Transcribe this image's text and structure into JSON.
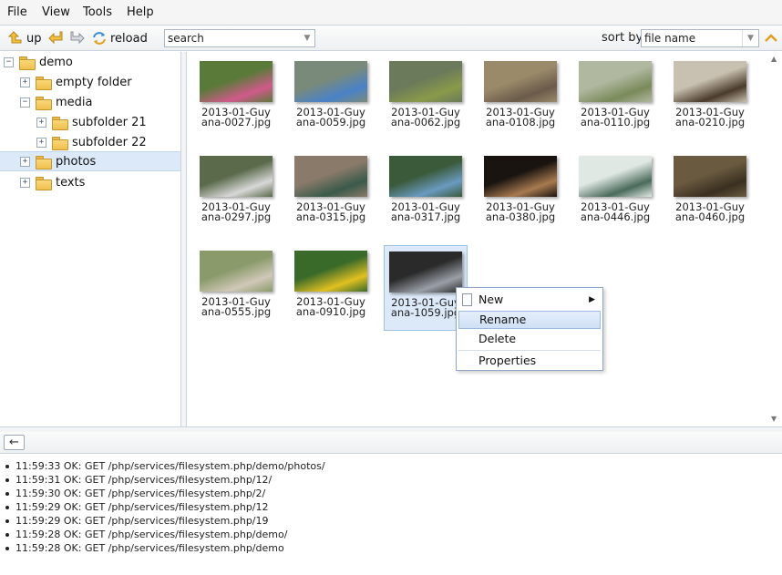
{
  "menu": [
    "File",
    "View",
    "Tools",
    "Help"
  ],
  "toolbar": {
    "up_label": "up",
    "reload_label": "reload",
    "search_value": "search",
    "sort_label": "sort by",
    "sort_value": "file name"
  },
  "tree": {
    "root": "demo",
    "items": {
      "empty": "empty folder",
      "media": "media",
      "sub21": "subfolder 21",
      "sub22": "subfolder 22",
      "photos": "photos",
      "texts": "texts"
    }
  },
  "files": [
    {
      "name": "2013-01-Guyana-0027.jpg",
      "colors": [
        "#5a7a3a",
        "#d05a8a"
      ]
    },
    {
      "name": "2013-01-Guyana-0059.jpg",
      "colors": [
        "#7a8a7a",
        "#4a82c8"
      ]
    },
    {
      "name": "2013-01-Guyana-0062.jpg",
      "colors": [
        "#6a7a5a",
        "#8a9a4a"
      ]
    },
    {
      "name": "2013-01-Guyana-0108.jpg",
      "colors": [
        "#9a8a6a",
        "#6a5a4a"
      ]
    },
    {
      "name": "2013-01-Guyana-0110.jpg",
      "colors": [
        "#b0b8a0",
        "#7a8a5a"
      ]
    },
    {
      "name": "2013-01-Guyana-0210.jpg",
      "colors": [
        "#c8c0b0",
        "#4a3a2a"
      ]
    },
    {
      "name": "2013-01-Guyana-0297.jpg",
      "colors": [
        "#5a6a4a",
        "#d8d8d8"
      ]
    },
    {
      "name": "2013-01-Guyana-0315.jpg",
      "colors": [
        "#8a7a6a",
        "#3a5a4a"
      ]
    },
    {
      "name": "2013-01-Guyana-0317.jpg",
      "colors": [
        "#3a5a3a",
        "#6a9ac0"
      ]
    },
    {
      "name": "2013-01-Guyana-0380.jpg",
      "colors": [
        "#1a1410",
        "#a87a50"
      ]
    },
    {
      "name": "2013-01-Guyana-0446.jpg",
      "colors": [
        "#e0e8e4",
        "#4a6a5a"
      ]
    },
    {
      "name": "2013-01-Guyana-0460.jpg",
      "colors": [
        "#6a5a40",
        "#3a3020"
      ]
    },
    {
      "name": "2013-01-Guyana-0555.jpg",
      "colors": [
        "#8a9a6a",
        "#d0c8b8"
      ]
    },
    {
      "name": "2013-01-Guyana-0910.jpg",
      "colors": [
        "#3a6a2a",
        "#e0c020"
      ]
    },
    {
      "name": "2013-01-Guyana-1059.jpg",
      "colors": [
        "#2a2a2a",
        "#9aa0a8"
      ]
    }
  ],
  "context_menu": {
    "new": "New",
    "rename": "Rename",
    "delete": "Delete",
    "properties": "Properties"
  },
  "log": [
    "11:59:33 OK: GET /php/services/filesystem.php/demo/photos/",
    "11:59:31 OK: GET /php/services/filesystem.php/12/",
    "11:59:30 OK: GET /php/services/filesystem.php/2/",
    "11:59:29 OK: GET /php/services/filesystem.php/12",
    "11:59:29 OK: GET /php/services/filesystem.php/19",
    "11:59:28 OK: GET /php/services/filesystem.php/demo/",
    "11:59:28 OK: GET /php/services/filesystem.php/demo"
  ]
}
